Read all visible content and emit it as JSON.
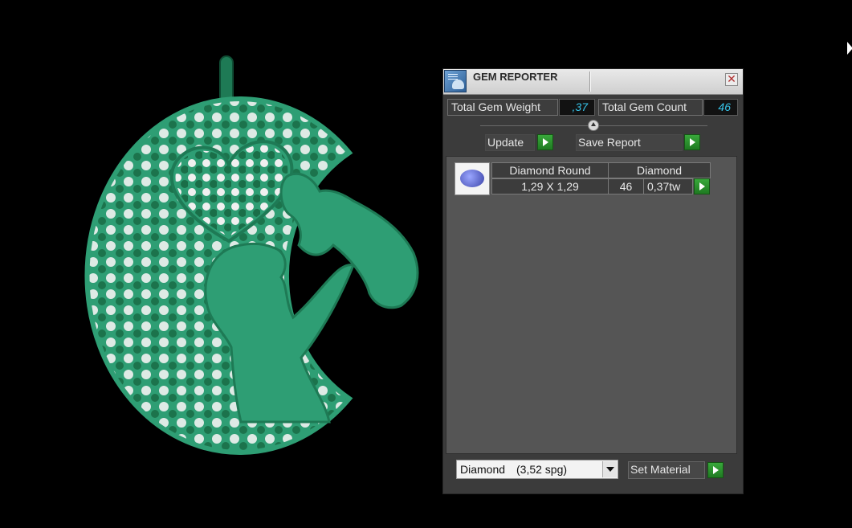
{
  "window": {
    "title": "GEM REPORTER",
    "close_glyph": "✕"
  },
  "totals": {
    "weight_label": "Total Gem Weight",
    "weight_value": ",37",
    "count_label": "Total Gem Count",
    "count_value": "46"
  },
  "actions": {
    "update_label": "Update",
    "save_label": "Save Report"
  },
  "report": {
    "rows": [
      {
        "shape": "Diamond Round",
        "material": "Diamond",
        "size": "1,29 X 1,29",
        "count": "46",
        "weight": "0,37tw"
      }
    ]
  },
  "material": {
    "selected_name": "Diamond",
    "selected_density": "(3,52 spg)",
    "set_label": "Set Material"
  },
  "colors": {
    "accent_value": "#36c3e8",
    "go_button": "#2a922c",
    "model_green": "#2e9e74"
  },
  "icons": {
    "title": "gem-reporter-icon",
    "close": "close-icon",
    "go": "play-arrow-icon",
    "thumb": "gem-thumbnail-icon"
  }
}
